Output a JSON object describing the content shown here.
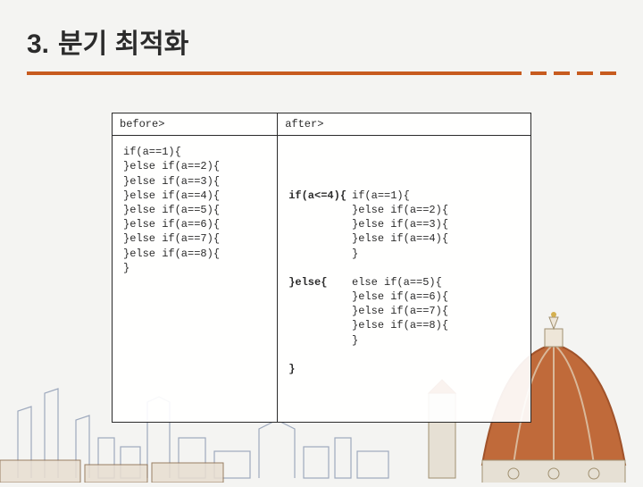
{
  "title": {
    "number": "3.",
    "text": "분기 최적화"
  },
  "table": {
    "headers": {
      "before": "before>",
      "after": "after>"
    },
    "before_code": "if(a==1){\n}else if(a==2){\n}else if(a==3){\n}else if(a==4){\n}else if(a==5){\n}else if(a==6){\n}else if(a==7){\n}else if(a==8){\n}",
    "after_col1": {
      "line1": "if(a<=4){",
      "line2": "",
      "line3": "",
      "line4": "",
      "line5": "",
      "line6": "",
      "line7": "}else{",
      "line8": "",
      "line9": "",
      "line10": "",
      "line11": "",
      "line12": "",
      "line13": "}"
    },
    "after_col2": "\nif(a==1){\n}else if(a==2){\n}else if(a==3){\n}else if(a==4){\n}\n\nelse if(a==5){\n}else if(a==6){\n}else if(a==7){\n}else if(a==8){\n}"
  }
}
